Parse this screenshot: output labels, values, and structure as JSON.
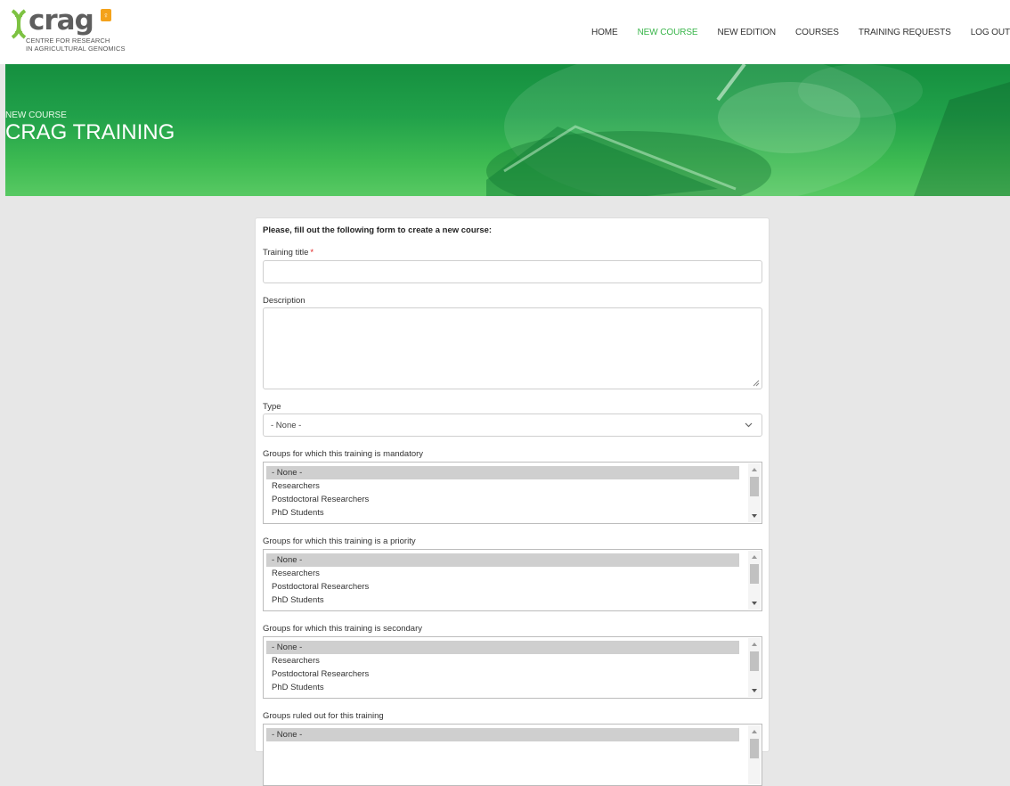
{
  "header": {
    "logo": {
      "word": "crag",
      "badge": "♀",
      "sub_line1": "CENTRE FOR RESEARCH",
      "sub_line2": "IN AGRICULTURAL GENOMICS"
    },
    "nav": [
      {
        "label": "HOME",
        "active": false
      },
      {
        "label": "NEW COURSE",
        "active": true
      },
      {
        "label": "NEW EDITION",
        "active": false
      },
      {
        "label": "COURSES",
        "active": false
      },
      {
        "label": "TRAINING REQUESTS",
        "active": false
      },
      {
        "label": "LOG OUT",
        "active": false
      }
    ]
  },
  "hero": {
    "eyebrow": "NEW COURSE",
    "title": "CRAG TRAINING"
  },
  "form": {
    "intro": "Please, fill out the following form to create a new course:",
    "title_field": {
      "label": "Training title",
      "required_mark": "*",
      "value": ""
    },
    "description_field": {
      "label": "Description",
      "value": ""
    },
    "type_field": {
      "label": "Type",
      "value": "- None -"
    },
    "group_fields": [
      {
        "label": "Groups for which this training is mandatory",
        "options": [
          "- None -",
          "Researchers",
          "Postdoctoral Researchers",
          "PhD Students"
        ],
        "selected": "- None -"
      },
      {
        "label": "Groups for which this training is a priority",
        "options": [
          "- None -",
          "Researchers",
          "Postdoctoral Researchers",
          "PhD Students"
        ],
        "selected": "- None -"
      },
      {
        "label": "Groups for which this training is secondary",
        "options": [
          "- None -",
          "Researchers",
          "Postdoctoral Researchers",
          "PhD Students"
        ],
        "selected": "- None -"
      },
      {
        "label": "Groups ruled out for this training",
        "options": [
          "- None -"
        ],
        "selected": "- None -"
      }
    ]
  },
  "colors": {
    "accent_green": "#39b54a",
    "hero_green": "#21a14a",
    "page_bg": "#e7e7e7",
    "required_red": "#e02020"
  }
}
